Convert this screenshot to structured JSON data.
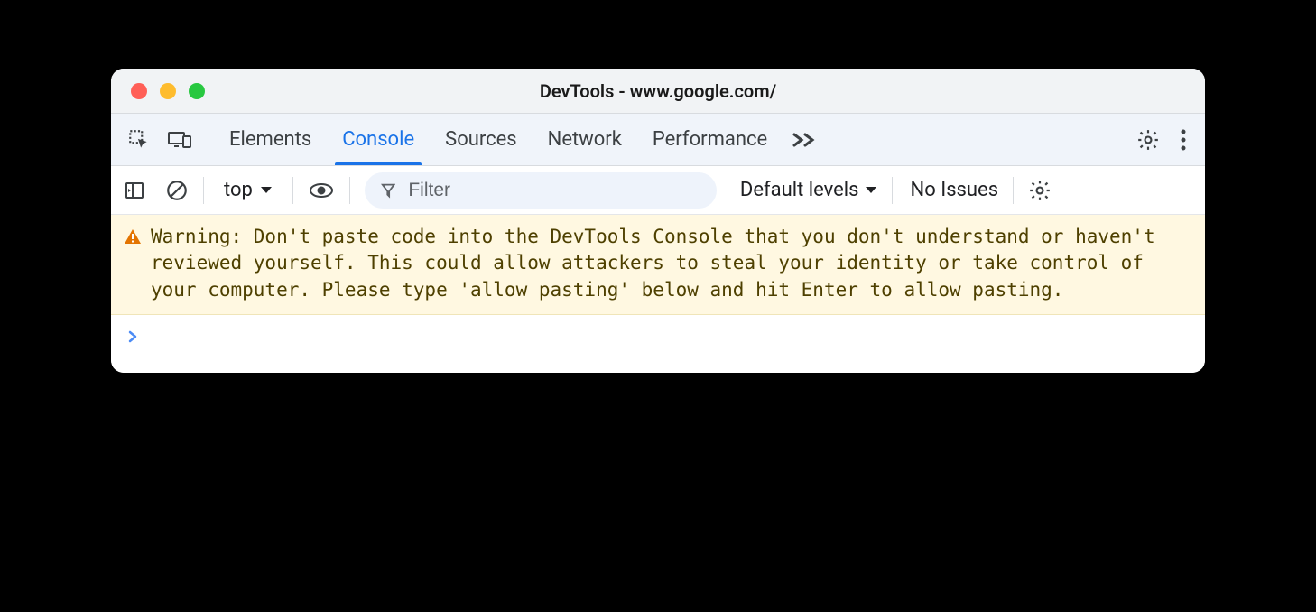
{
  "window": {
    "title": "DevTools - www.google.com/"
  },
  "tabs": {
    "items": [
      "Elements",
      "Console",
      "Sources",
      "Network",
      "Performance"
    ],
    "active_index": 1
  },
  "toolbar": {
    "context": "top",
    "filter_placeholder": "Filter",
    "levels_label": "Default levels",
    "issues_label": "No Issues"
  },
  "console": {
    "warning_text": "Warning: Don't paste code into the DevTools Console that you don't understand or haven't reviewed yourself. This could allow attackers to steal your identity or take control of your computer. Please type 'allow pasting' below and hit Enter to allow pasting."
  }
}
